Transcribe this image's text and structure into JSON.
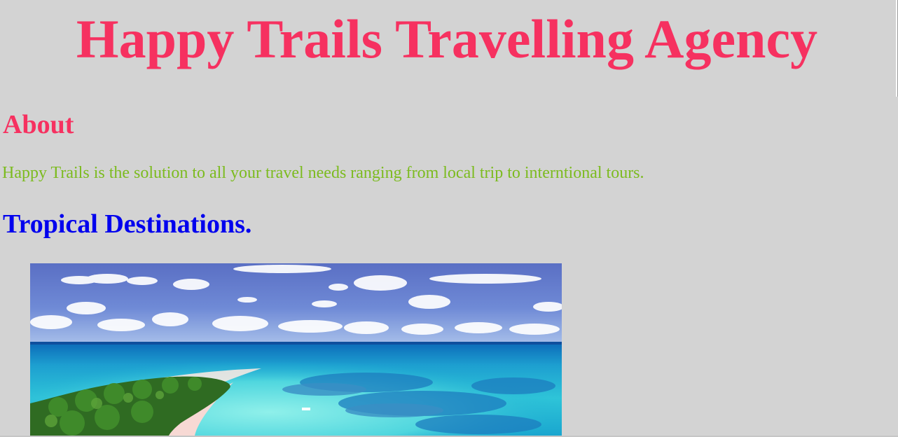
{
  "header": {
    "title": "Happy Trails Travelling Agency"
  },
  "about": {
    "heading": "About",
    "text": "Happy Trails is the solution to all your travel needs ranging from local trip to interntional tours."
  },
  "destinations": {
    "heading": "Tropical Destinations."
  },
  "colors": {
    "title": "#f63160",
    "about_heading": "#f63160",
    "about_text": "#7cbb1f",
    "destinations_heading": "#0000ee",
    "background": "#d3d3d3"
  }
}
